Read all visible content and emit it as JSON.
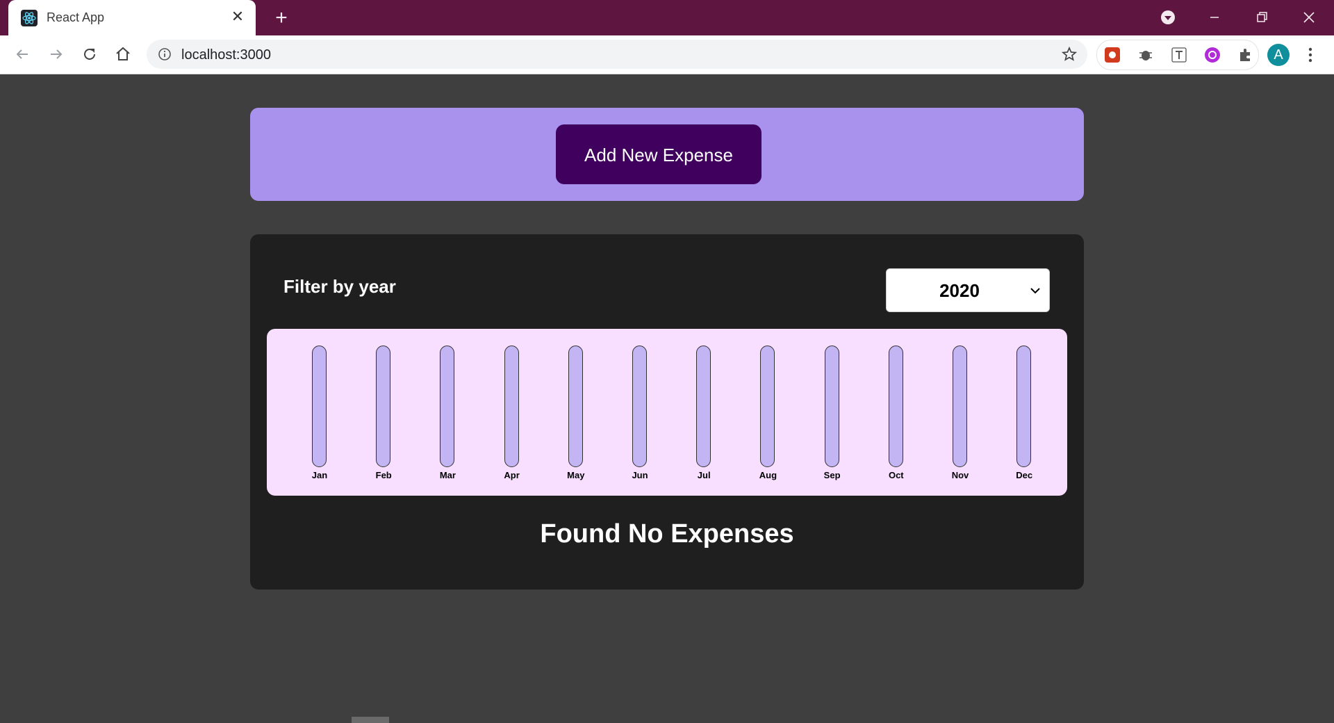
{
  "browser": {
    "tab_title": "React App",
    "url": "localhost:3000",
    "avatar_letter": "A",
    "colors": {
      "titlebar": "#5e1640",
      "toolbar": "#ffffff"
    }
  },
  "app": {
    "add_button_label": "Add New Expense",
    "filter_label": "Filter by year",
    "selected_year": "2020",
    "empty_message": "Found No Expenses",
    "colors": {
      "new_expense_bg": "#a892ee",
      "add_button_bg": "#40005d",
      "expenses_bg": "#1f1f1f",
      "chart_bg": "#f8dfff",
      "bar_bg": "#c3b4f3",
      "page_bg": "#3f3f3f"
    }
  },
  "chart_data": {
    "type": "bar",
    "categories": [
      "Jan",
      "Feb",
      "Mar",
      "Apr",
      "May",
      "Jun",
      "Jul",
      "Aug",
      "Sep",
      "Oct",
      "Nov",
      "Dec"
    ],
    "values": [
      0,
      0,
      0,
      0,
      0,
      0,
      0,
      0,
      0,
      0,
      0,
      0
    ]
  }
}
